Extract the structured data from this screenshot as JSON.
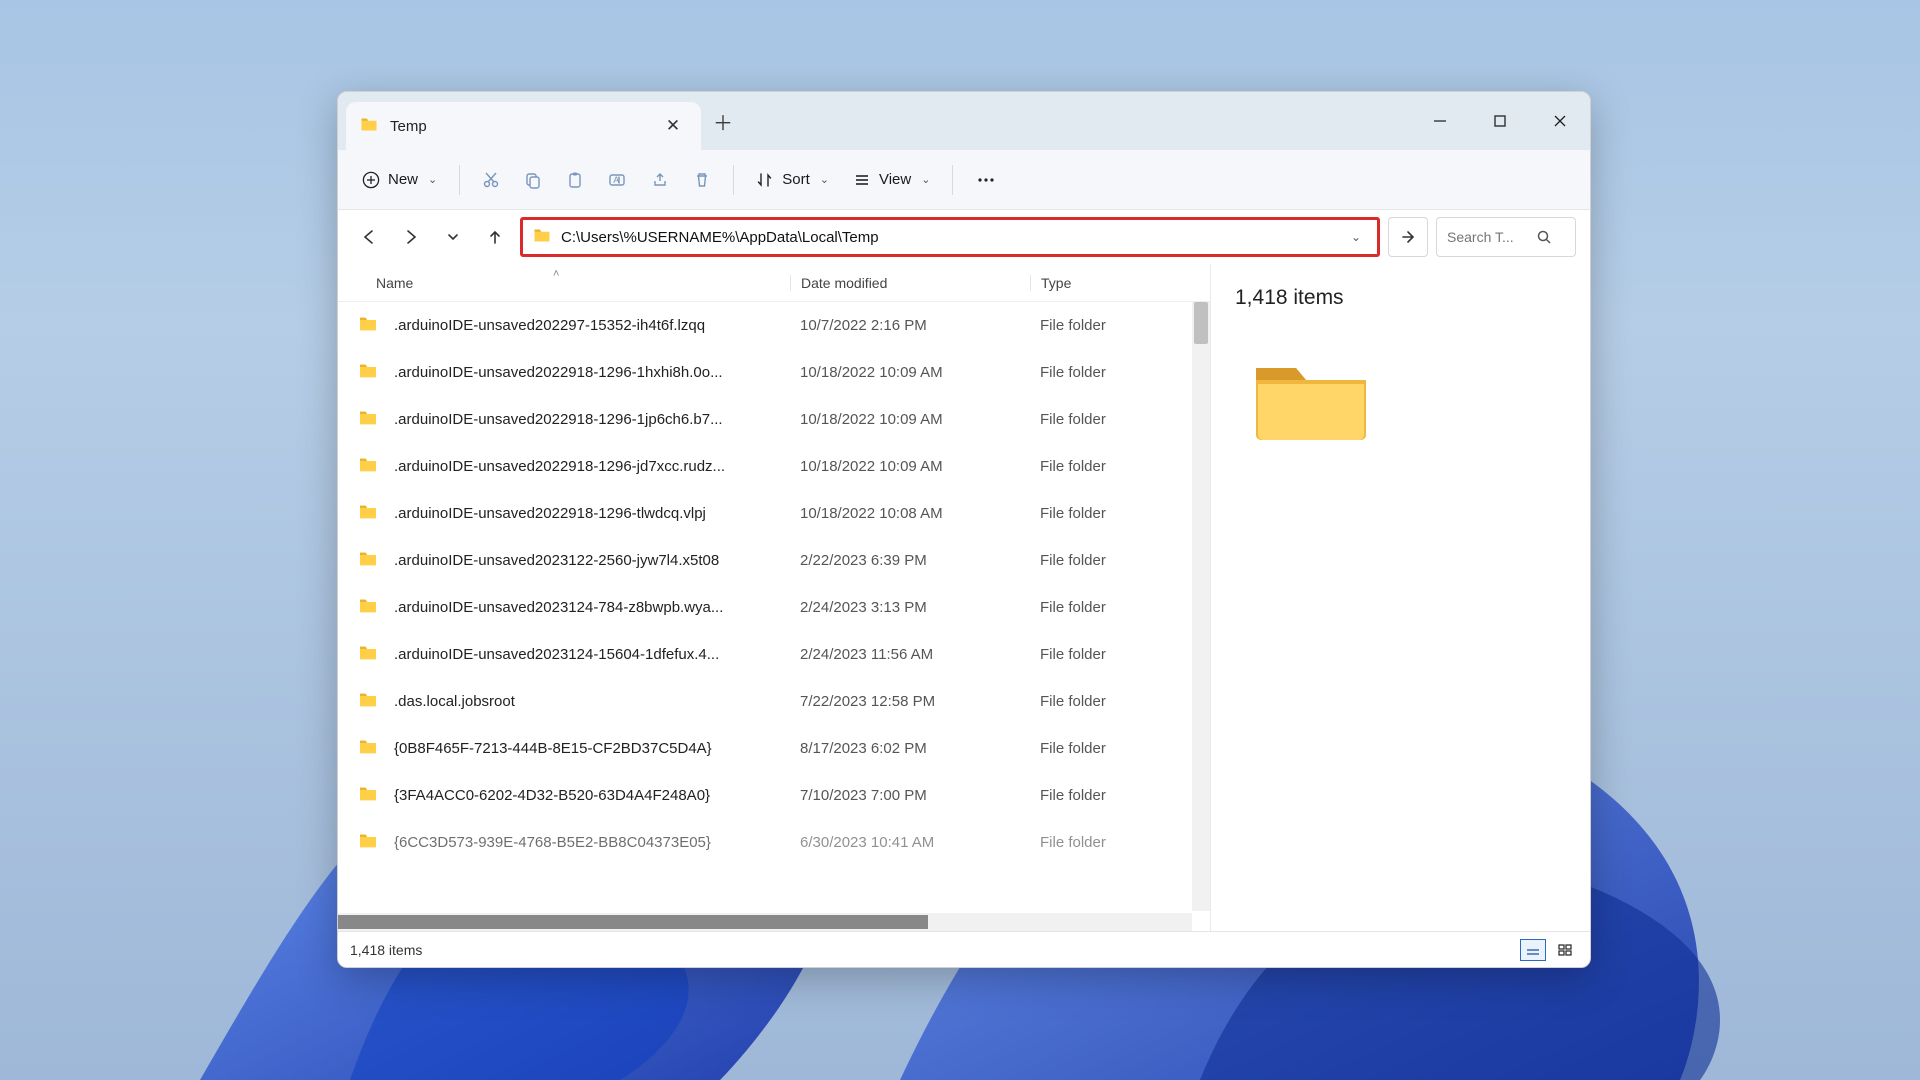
{
  "tab": {
    "title": "Temp"
  },
  "toolbar": {
    "new_label": "New",
    "sort_label": "Sort",
    "view_label": "View"
  },
  "address_path": "C:\\Users\\%USERNAME%\\AppData\\Local\\Temp",
  "search": {
    "placeholder": "Search T..."
  },
  "columns": {
    "name": "Name",
    "date": "Date modified",
    "type": "Type"
  },
  "details": {
    "count_label": "1,418 items"
  },
  "status": {
    "count_label": "1,418 items"
  },
  "file_type_folder": "File folder",
  "files": [
    {
      "name": ".arduinoIDE-unsaved202297-15352-ih4t6f.lzqq",
      "date": "10/7/2022 2:16 PM",
      "type": "File folder"
    },
    {
      "name": ".arduinoIDE-unsaved2022918-1296-1hxhi8h.0o...",
      "date": "10/18/2022 10:09 AM",
      "type": "File folder"
    },
    {
      "name": ".arduinoIDE-unsaved2022918-1296-1jp6ch6.b7...",
      "date": "10/18/2022 10:09 AM",
      "type": "File folder"
    },
    {
      "name": ".arduinoIDE-unsaved2022918-1296-jd7xcc.rudz...",
      "date": "10/18/2022 10:09 AM",
      "type": "File folder"
    },
    {
      "name": ".arduinoIDE-unsaved2022918-1296-tlwdcq.vlpj",
      "date": "10/18/2022 10:08 AM",
      "type": "File folder"
    },
    {
      "name": ".arduinoIDE-unsaved2023122-2560-jyw7l4.x5t08",
      "date": "2/22/2023 6:39 PM",
      "type": "File folder"
    },
    {
      "name": ".arduinoIDE-unsaved2023124-784-z8bwpb.wya...",
      "date": "2/24/2023 3:13 PM",
      "type": "File folder"
    },
    {
      "name": ".arduinoIDE-unsaved2023124-15604-1dfefux.4...",
      "date": "2/24/2023 11:56 AM",
      "type": "File folder"
    },
    {
      "name": ".das.local.jobsroot",
      "date": "7/22/2023 12:58 PM",
      "type": "File folder"
    },
    {
      "name": "{0B8F465F-7213-444B-8E15-CF2BD37C5D4A}",
      "date": "8/17/2023 6:02 PM",
      "type": "File folder"
    },
    {
      "name": "{3FA4ACC0-6202-4D32-B520-63D4A4F248A0}",
      "date": "7/10/2023 7:00 PM",
      "type": "File folder"
    },
    {
      "name": "{6CC3D573-939E-4768-B5E2-BB8C04373E05}",
      "date": "6/30/2023 10:41 AM",
      "type": "File folder"
    }
  ]
}
